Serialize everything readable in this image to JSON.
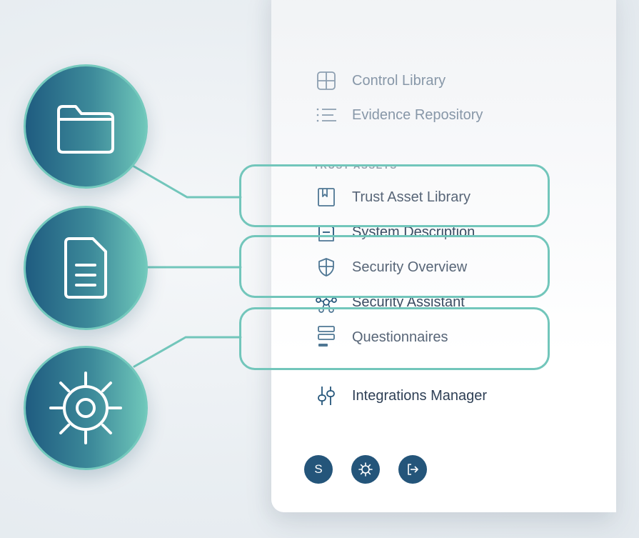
{
  "sidebar": {
    "items": [
      {
        "label": "Control Library",
        "icon": "grid-icon"
      },
      {
        "label": "Evidence Repository",
        "icon": "list-icon"
      }
    ],
    "section_label": "TRUST ASSETS",
    "trust_items": [
      {
        "label": "Trust Asset Library",
        "icon": "bookmark-icon"
      },
      {
        "label": "System Description",
        "icon": "document-icon"
      },
      {
        "label": "Security Overview",
        "icon": "shield-icon"
      },
      {
        "label": "Security Assistant",
        "icon": "network-icon"
      },
      {
        "label": "Questionnaires",
        "icon": "stacked-bars-icon"
      }
    ],
    "integrations": {
      "label": "Integrations Manager",
      "icon": "sliders-icon"
    }
  },
  "footer": {
    "avatar_initial": "S",
    "settings_icon": "gear-icon",
    "logout_icon": "logout-icon"
  },
  "feature_circles": [
    {
      "icon": "folder-icon"
    },
    {
      "icon": "file-icon"
    },
    {
      "icon": "gear-icon"
    }
  ],
  "colors": {
    "accent_teal": "#72c6bb",
    "brand_navy": "#24557a",
    "text_dark": "#2e3f55",
    "text_muted": "#8797a8"
  }
}
